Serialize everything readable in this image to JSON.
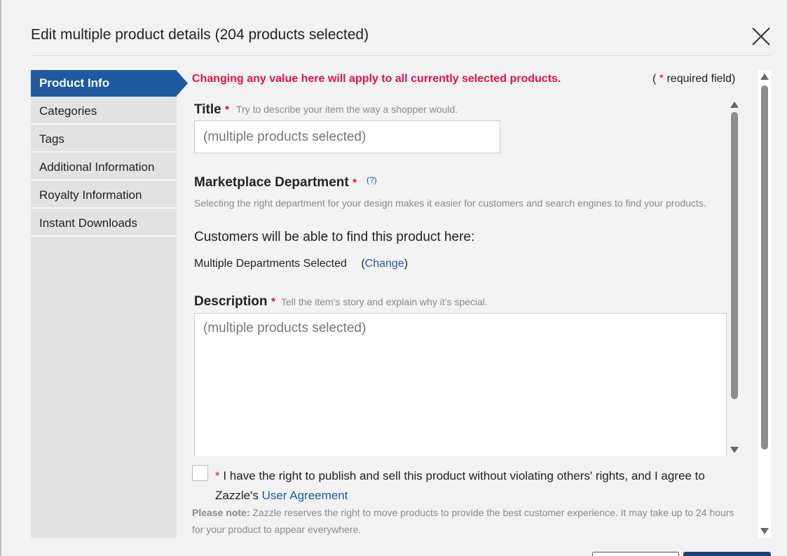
{
  "dialog": {
    "title": "Edit multiple product details (204 products selected)",
    "close_icon": "close-icon"
  },
  "nav": {
    "items": [
      {
        "label": "Product Info",
        "active": true
      },
      {
        "label": "Categories",
        "active": false
      },
      {
        "label": "Tags",
        "active": false
      },
      {
        "label": "Additional Information",
        "active": false
      },
      {
        "label": "Royalty Information",
        "active": false
      },
      {
        "label": "Instant Downloads",
        "active": false
      }
    ]
  },
  "notice": {
    "warning": "Changing any value here will apply to all currently selected products.",
    "required_prefix": "(",
    "required_star": "*",
    "required_suffix": "required field)"
  },
  "form": {
    "title": {
      "label": "Title",
      "star": "*",
      "hint": "Try to describe your item the way a shopper would.",
      "value": "(multiple products selected)"
    },
    "department": {
      "label": "Marketplace Department",
      "star": "*",
      "help": "(?)",
      "hint": "Selecting the right department for your design makes it easier for customers and search engines to find your products.",
      "find_text": "Customers will be able to find this product here:",
      "selected": "Multiple Departments Selected",
      "change_open": "(",
      "change_link": "Change",
      "change_close": ")"
    },
    "description": {
      "label": "Description",
      "star": "*",
      "hint": "Tell the item's story and explain why it's special.",
      "value": "(multiple products selected)"
    }
  },
  "agreement": {
    "star": "*",
    "text": "I have the right to publish and sell this product without violating others' rights, and I agree to Zazzle's",
    "link": "User Agreement"
  },
  "note": {
    "prefix": "Please note:",
    "text": "Zazzle reserves the right to move products to provide the best customer experience. It may take up to 24 hours for your product to appear everywhere."
  },
  "colors": {
    "accent": "#1f5aa0",
    "warning": "#e0124a",
    "required": "#d6143f"
  }
}
